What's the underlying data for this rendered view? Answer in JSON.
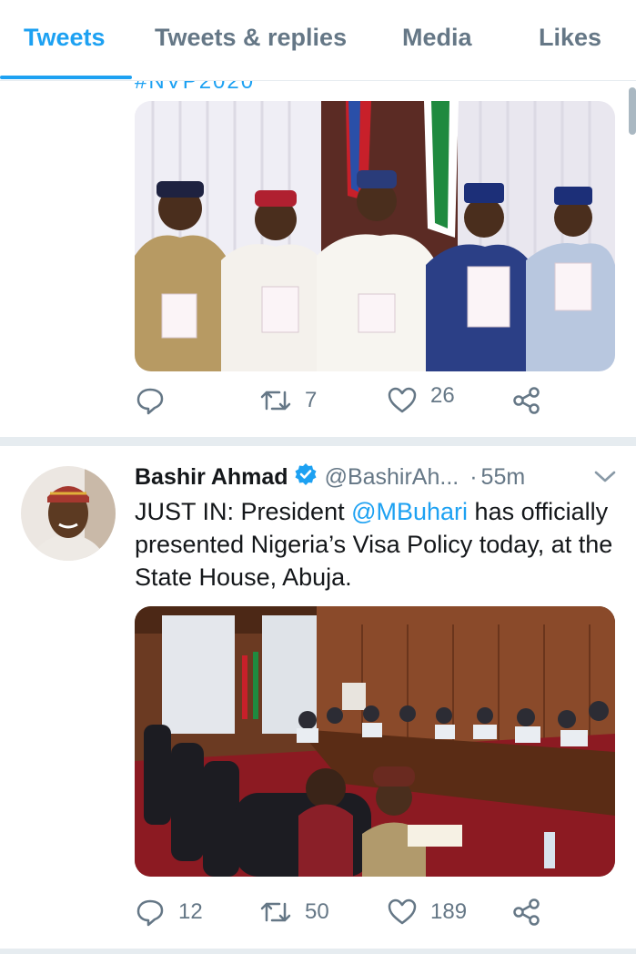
{
  "tabs": [
    {
      "label": "Tweets",
      "active": true
    },
    {
      "label": "Tweets & replies",
      "active": false
    },
    {
      "label": "Media",
      "active": false
    },
    {
      "label": "Likes",
      "active": false
    }
  ],
  "prev_tweet": {
    "hashtag_partial": "#NVP2020",
    "actions": {
      "reply": "",
      "retweets": "7",
      "likes": "26"
    }
  },
  "tweet": {
    "name": "Bashir Ahmad",
    "verified": true,
    "handle": "@BashirAh...",
    "time": "55m",
    "text_before": "JUST IN: President ",
    "mention": "@MBuhari",
    "text_after": " has officially presented Nigeria’s Visa Policy today, at the State House, Abuja.",
    "actions": {
      "replies": "12",
      "retweets": "50",
      "likes": "189"
    }
  },
  "colors": {
    "accent": "#1da1f2",
    "muted": "#657786",
    "text": "#14171a",
    "divider": "#e6ecf0"
  },
  "icons": [
    "reply-icon",
    "retweet-icon",
    "like-icon",
    "share-icon",
    "verified-badge-icon",
    "chevron-down-icon"
  ]
}
